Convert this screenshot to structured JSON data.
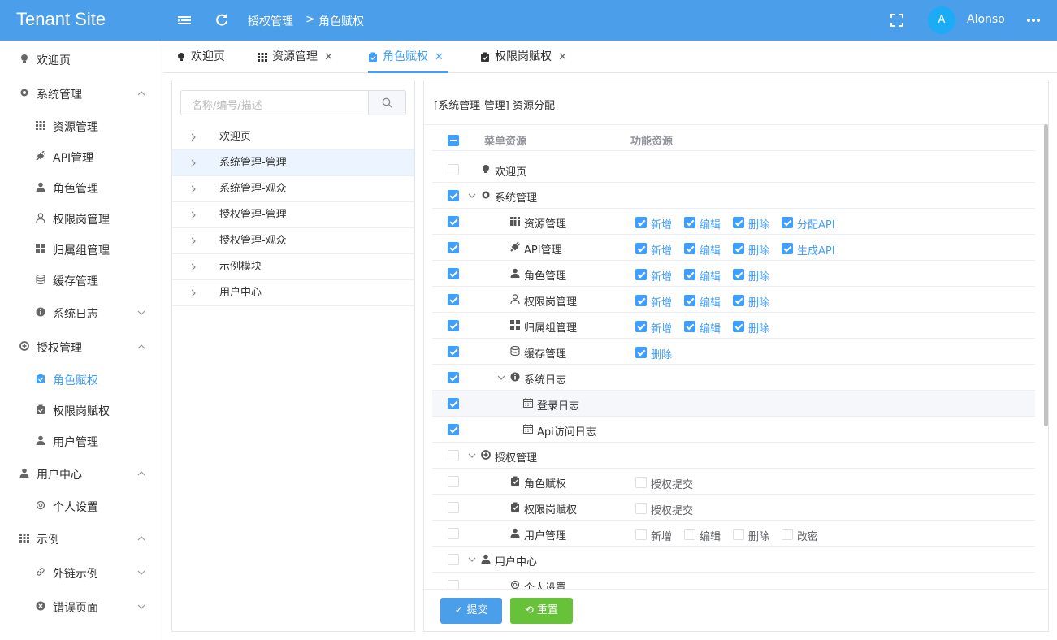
{
  "app": {
    "title": "Tenant Site",
    "user": "Alonso",
    "avatar_letter": "A"
  },
  "breadcrumb": [
    "授权管理",
    "角色赋权"
  ],
  "sidebar": {
    "items": [
      {
        "label": "欢迎页",
        "icon": "bulb-icon"
      },
      {
        "label": "系统管理",
        "icon": "gear-icon"
      },
      {
        "label": "资源管理",
        "icon": "grid-icon"
      },
      {
        "label": "API管理",
        "icon": "plug-icon"
      },
      {
        "label": "角色管理",
        "icon": "user-icon"
      },
      {
        "label": "权限岗管理",
        "icon": "user-outline-icon"
      },
      {
        "label": "归属组管理",
        "icon": "apps-icon"
      },
      {
        "label": "缓存管理",
        "icon": "database-icon"
      },
      {
        "label": "系统日志",
        "icon": "info-icon"
      },
      {
        "label": "授权管理",
        "icon": "plus-circle-icon"
      },
      {
        "label": "角色赋权",
        "icon": "clipboard-icon"
      },
      {
        "label": "权限岗赋权",
        "icon": "clipboard-icon"
      },
      {
        "label": "用户管理",
        "icon": "user-icon"
      },
      {
        "label": "用户中心",
        "icon": "user-icon"
      },
      {
        "label": "个人设置",
        "icon": "gear-outline-icon"
      },
      {
        "label": "示例",
        "icon": "grid-icon"
      },
      {
        "label": "外链示例",
        "icon": "link-icon"
      },
      {
        "label": "错误页面",
        "icon": "close-circle-icon"
      }
    ]
  },
  "tabs": [
    {
      "label": "欢迎页",
      "closable": false
    },
    {
      "label": "资源管理",
      "closable": true
    },
    {
      "label": "角色赋权",
      "closable": true
    },
    {
      "label": "权限岗赋权",
      "closable": true
    }
  ],
  "left_panel": {
    "search_placeholder": "名称/编号/描述",
    "roles": [
      "欢迎页",
      "系统管理-管理",
      "系统管理-观众",
      "授权管理-管理",
      "授权管理-观众",
      "示例模块",
      "用户中心"
    ],
    "selected": "系统管理-管理"
  },
  "right_panel": {
    "title": "[系统管理-管理] 资源分配",
    "col_menu": "菜单资源",
    "col_func": "功能资源",
    "rows": [
      {
        "label": "欢迎页",
        "checked": false,
        "perms": []
      },
      {
        "label": "系统管理",
        "checked": true,
        "perms": []
      },
      {
        "label": "资源管理",
        "checked": true,
        "perms": [
          {
            "label": "新增",
            "on": true
          },
          {
            "label": "编辑",
            "on": true
          },
          {
            "label": "删除",
            "on": true
          },
          {
            "label": "分配API",
            "on": true
          }
        ]
      },
      {
        "label": "API管理",
        "checked": true,
        "perms": [
          {
            "label": "新增",
            "on": true
          },
          {
            "label": "编辑",
            "on": true
          },
          {
            "label": "删除",
            "on": true
          },
          {
            "label": "生成API",
            "on": true
          }
        ]
      },
      {
        "label": "角色管理",
        "checked": true,
        "perms": [
          {
            "label": "新增",
            "on": true
          },
          {
            "label": "编辑",
            "on": true
          },
          {
            "label": "删除",
            "on": true
          }
        ]
      },
      {
        "label": "权限岗管理",
        "checked": true,
        "perms": [
          {
            "label": "新增",
            "on": true
          },
          {
            "label": "编辑",
            "on": true
          },
          {
            "label": "删除",
            "on": true
          }
        ]
      },
      {
        "label": "归属组管理",
        "checked": true,
        "perms": [
          {
            "label": "新增",
            "on": true
          },
          {
            "label": "编辑",
            "on": true
          },
          {
            "label": "删除",
            "on": true
          }
        ]
      },
      {
        "label": "缓存管理",
        "checked": true,
        "perms": [
          {
            "label": "删除",
            "on": true
          }
        ]
      },
      {
        "label": "系统日志",
        "checked": true,
        "perms": []
      },
      {
        "label": "登录日志",
        "checked": true,
        "perms": []
      },
      {
        "label": "Api访问日志",
        "checked": true,
        "perms": []
      },
      {
        "label": "授权管理",
        "checked": false,
        "perms": []
      },
      {
        "label": "角色赋权",
        "checked": false,
        "perms": [
          {
            "label": "授权提交",
            "on": false
          }
        ]
      },
      {
        "label": "权限岗赋权",
        "checked": false,
        "perms": [
          {
            "label": "授权提交",
            "on": false
          }
        ]
      },
      {
        "label": "用户管理",
        "checked": false,
        "perms": [
          {
            "label": "新增",
            "on": false
          },
          {
            "label": "编辑",
            "on": false
          },
          {
            "label": "删除",
            "on": false
          },
          {
            "label": "改密",
            "on": false
          }
        ]
      },
      {
        "label": "用户中心",
        "checked": false,
        "perms": []
      },
      {
        "label": "个人设置",
        "checked": false,
        "perms": []
      }
    ],
    "submit_label": "提交",
    "reset_label": "重置"
  },
  "colors": {
    "primary": "#409eff",
    "topbar": "#4a9eea",
    "success": "#67c23a"
  }
}
